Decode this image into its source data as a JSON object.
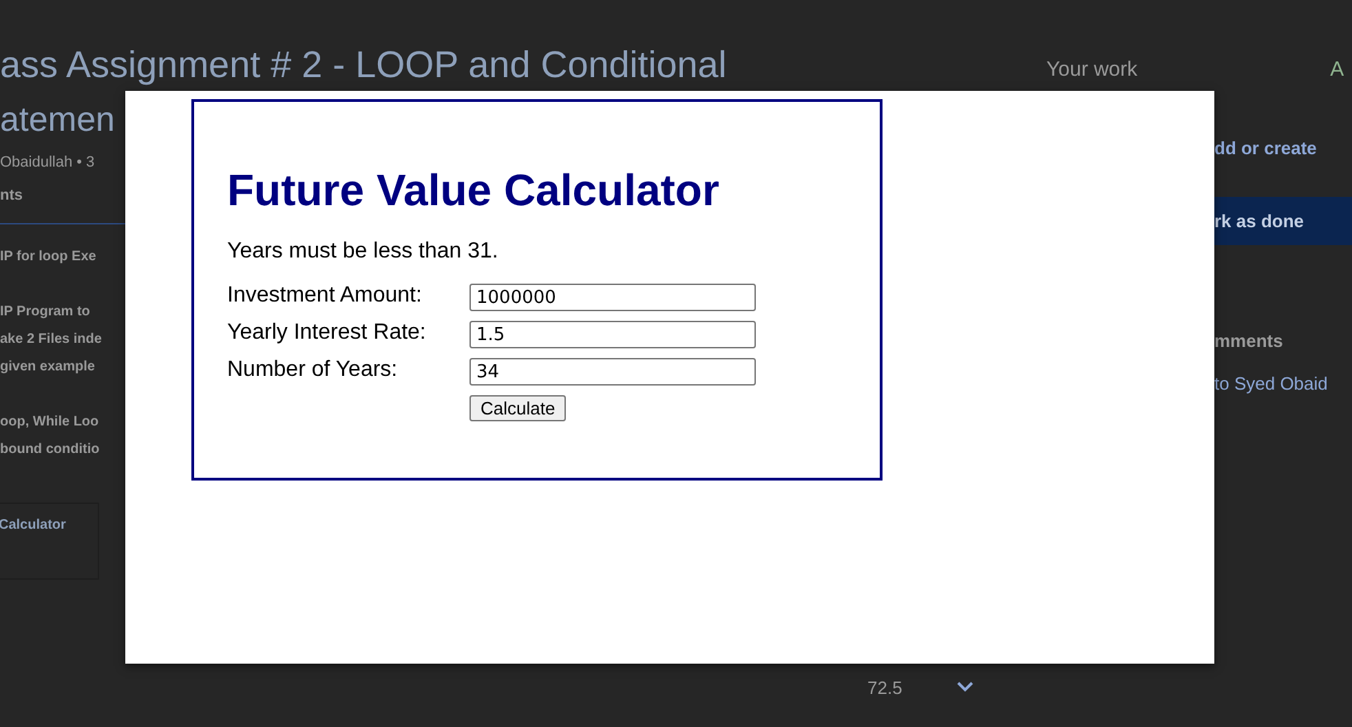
{
  "background_page": {
    "title_lines": [
      "ass Assignment # 2 - LOOP and Conditional",
      "atemen"
    ],
    "author": "Obaidullah • 3",
    "tab": "nts",
    "instruction_paragraphs": [
      [
        "IP for loop Exe"
      ],
      [
        "IP Program to",
        "ake 2 Files inde",
        "given example"
      ],
      [
        "oop, While Loo",
        "bound conditio"
      ]
    ],
    "attachment_title": "Calculator",
    "your_work": {
      "title": "Your work",
      "status": "A",
      "add_button": "dd or create",
      "done_button": "rk as done"
    },
    "comments": {
      "title": "mments",
      "link": "to Syed Obaid"
    },
    "grade": "72.5"
  },
  "modal": {
    "heading": "Future Value Calculator",
    "message": "Years must be less than 31.",
    "fields": [
      {
        "label": "Investment Amount:",
        "value": "1000000"
      },
      {
        "label": "Yearly Interest Rate:",
        "value": "1.5"
      },
      {
        "label": "Number of Years:",
        "value": "34"
      }
    ],
    "button": "Calculate"
  }
}
